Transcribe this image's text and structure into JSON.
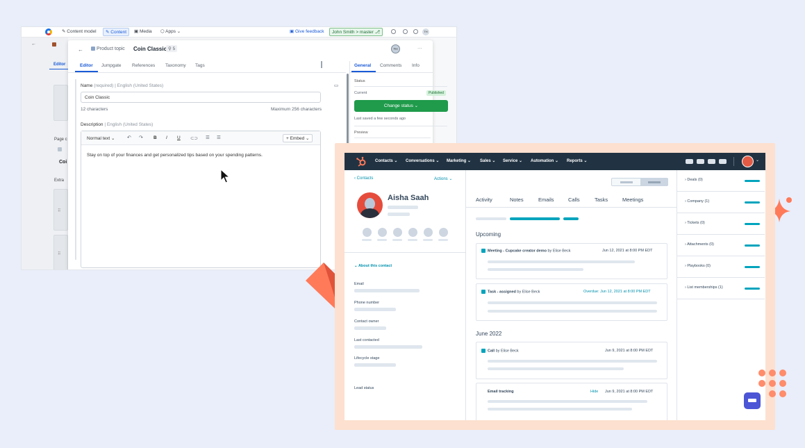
{
  "contentful": {
    "topbar": {
      "content_model": "Content model",
      "content": "Content",
      "media": "Media",
      "apps": "Apps",
      "give_feedback": "Give feedback",
      "branch": "John Smith > master",
      "avatar_initials": "TH"
    },
    "left": {
      "editor_tab": "Editor",
      "page_label": "Page c",
      "coin_label": "Coi",
      "extra_label": "Extra"
    },
    "entry": {
      "back": "←",
      "content_type": "Product topic",
      "title": "Coin Classic",
      "ref_count": "5",
      "avatar": "TH",
      "menu": "···",
      "tabs": [
        "Editor",
        "Jumpgate",
        "References",
        "Taxonomy",
        "Tags"
      ],
      "name_label": "Name",
      "name_required": "(required)",
      "name_locale": "English (United States)",
      "name_value": "Coin Classic",
      "char_count": "12 characters",
      "char_max": "Maximum 256 characters",
      "desc_label": "Description",
      "desc_locale": "English (United States)",
      "format_select": "Normal text",
      "embed": "+ Embed",
      "desc_value": "Stay on top of your finances and get personalized tips based on your spending patterns."
    },
    "sidebar": {
      "tabs": [
        "General",
        "Comments",
        "Info"
      ],
      "status_label": "Status",
      "current_label": "Current",
      "status_badge": "Published",
      "change_status": "Change status",
      "last_saved": "Last saved a few seconds ago",
      "preview_label": "Preview"
    }
  },
  "hubspot": {
    "nav": [
      "Contacts",
      "Conversations",
      "Marketing",
      "Sales",
      "Service",
      "Automation",
      "Reports"
    ],
    "left": {
      "back": "Contacts",
      "actions": "Actions",
      "name": "Aisha Saah",
      "about": "About this contact",
      "fields": [
        "Email",
        "Phone number",
        "Contact owner",
        "Last contacted",
        "Lifecycle stage",
        "Lead status"
      ]
    },
    "middle": {
      "tabs": [
        "Activity",
        "Notes",
        "Emails",
        "Calls",
        "Tasks",
        "Meetings"
      ],
      "upcoming": "Upcoming",
      "june": "June 2022",
      "activities": [
        {
          "title": "Meeting - Cupcake creator demo",
          "by": "by Elise Beck",
          "date": "Jun 12, 2021 at 8:00 PM EDT",
          "overdue": ""
        },
        {
          "title": "Task - assigned",
          "by": "by Elise Beck",
          "date": "Jun 12, 2021 at 8:00 PM EDT",
          "overdue": "Overdue:"
        },
        {
          "title": "Call",
          "by": "by Elise Beck",
          "date": "Jun 9, 2021 at 8:00 PM EDT",
          "overdue": ""
        },
        {
          "title": "Email tracking",
          "by": "",
          "date": "Jun 9, 2021 at 8:00 PM EDT",
          "overdue": "",
          "hide": "Hide"
        }
      ]
    },
    "right": [
      "Deals (0)",
      "Company (1)",
      "Tickets (0)",
      "Attachments (0)",
      "Playbooks (0)",
      "List memberships (1)"
    ]
  },
  "colors": {
    "hubspot_nav": "#213343",
    "teal": "#00a4bd",
    "green_button": "#1f9b4b",
    "accent_orange": "#ff7a59"
  }
}
